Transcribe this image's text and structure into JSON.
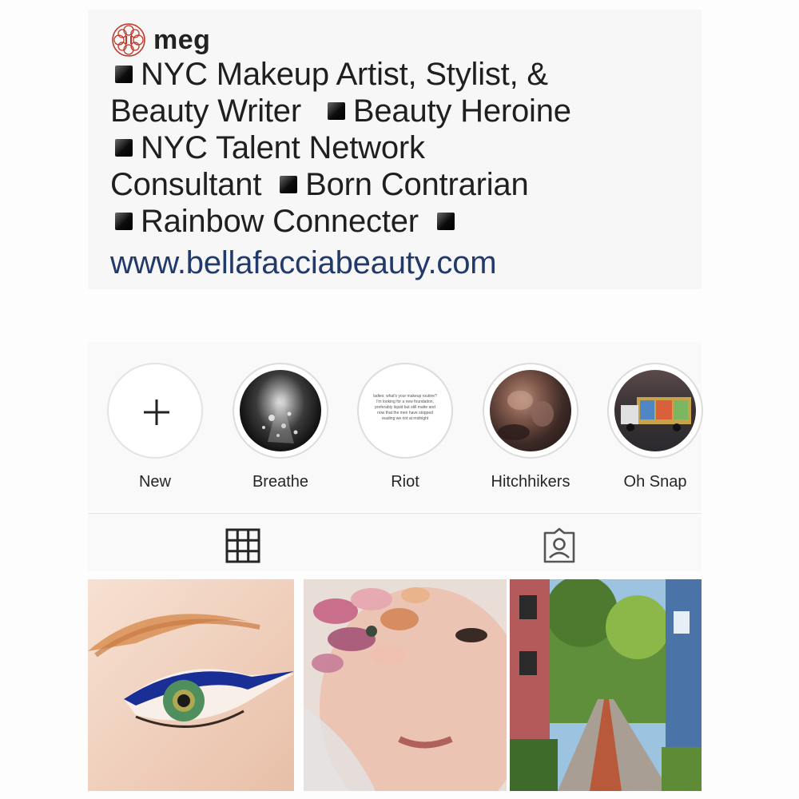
{
  "profile": {
    "username": "meg",
    "bio_lines": [
      "NYC Makeup Artist, Stylist, &",
      "Beauty Writer",
      "Beauty Heroine",
      "NYC Talent Network",
      "Consultant",
      "Born Contrarian",
      "Rainbow Connecter"
    ],
    "website": "www.bellafacciabeauty.com",
    "logo_icon": "floral-seal-icon",
    "link_color": "#213a6b"
  },
  "highlights": [
    {
      "label": "New",
      "icon": "plus-icon"
    },
    {
      "label": "Breathe"
    },
    {
      "label": "Riot",
      "preview_text": "ladies: what's your makeup routine? I'm looking for a new foundation, preferably liquid but still matte and now that the men have stopped reading we riot at midnight"
    },
    {
      "label": "Hitchhikers"
    },
    {
      "label": "Oh Snap"
    }
  ],
  "tabs": [
    {
      "name": "grid",
      "icon": "grid-icon",
      "active": true
    },
    {
      "name": "tagged",
      "icon": "tagged-person-icon",
      "active": false
    }
  ],
  "posts": [
    {
      "subject": "blue winged eyeliner close-up"
    },
    {
      "subject": "face with dried flower petals over eye"
    },
    {
      "subject": "brick garden path beside houses"
    }
  ]
}
